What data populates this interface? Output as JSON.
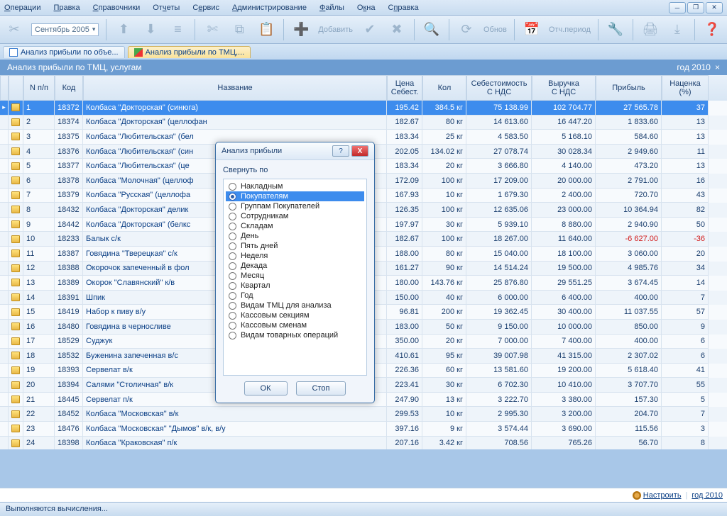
{
  "menus": [
    "Операции",
    "Правка",
    "Справочники",
    "Отчеты",
    "Сервис",
    "Администрирование",
    "Файлы",
    "Окна",
    "Справка"
  ],
  "toolbar": {
    "date": "Сентябрь 2005",
    "add": "Добавить",
    "refresh": "Обнов",
    "acct_period": "Отч.период"
  },
  "tabs": [
    {
      "label": "Анализ прибыли по объе..."
    },
    {
      "label": "Анализ прибыли по ТМЦ,..."
    }
  ],
  "doc_title": "Анализ прибыли по ТМЦ, услугам",
  "doc_period": "год 2010",
  "headers": {
    "np": "N п/п",
    "code": "Код",
    "name": "Название",
    "price": "Цена\nСебест.",
    "qty": "Кол",
    "cost": "Себестоимость\nС НДС",
    "rev": "Выручка\nС НДС",
    "profit": "Прибыль",
    "margin": "Наценка\n(%)"
  },
  "rows": [
    {
      "n": "1",
      "code": "18372",
      "name": "Колбаса \"Докторская\" (синюга)",
      "price": "195.42",
      "qty": "384.5 кг",
      "cost": "75 138.99",
      "rev": "102 704.77",
      "profit": "27 565.78",
      "mar": "37",
      "sel": true
    },
    {
      "n": "2",
      "code": "18374",
      "name": "Колбаса \"Докторская\" (целлофан",
      "price": "182.67",
      "qty": "80 кг",
      "cost": "14 613.60",
      "rev": "16 447.20",
      "profit": "1 833.60",
      "mar": "13"
    },
    {
      "n": "3",
      "code": "18375",
      "name": "Колбаса \"Любительская\" (бел",
      "price": "183.34",
      "qty": "25 кг",
      "cost": "4 583.50",
      "rev": "5 168.10",
      "profit": "584.60",
      "mar": "13"
    },
    {
      "n": "4",
      "code": "18376",
      "name": "Колбаса \"Любительская\" (син",
      "price": "202.05",
      "qty": "134.02 кг",
      "cost": "27 078.74",
      "rev": "30 028.34",
      "profit": "2 949.60",
      "mar": "11"
    },
    {
      "n": "5",
      "code": "18377",
      "name": "Колбаса \"Любительская\" (це",
      "price": "183.34",
      "qty": "20 кг",
      "cost": "3 666.80",
      "rev": "4 140.00",
      "profit": "473.20",
      "mar": "13"
    },
    {
      "n": "6",
      "code": "18378",
      "name": "Колбаса \"Молочная\" (целлоф",
      "price": "172.09",
      "qty": "100 кг",
      "cost": "17 209.00",
      "rev": "20 000.00",
      "profit": "2 791.00",
      "mar": "16"
    },
    {
      "n": "7",
      "code": "18379",
      "name": "Колбаса \"Русская\" (целлофа",
      "price": "167.93",
      "qty": "10 кг",
      "cost": "1 679.30",
      "rev": "2 400.00",
      "profit": "720.70",
      "mar": "43"
    },
    {
      "n": "8",
      "code": "18432",
      "name": "Колбаса \"Докторская\" делик",
      "price": "126.35",
      "qty": "100 кг",
      "cost": "12 635.06",
      "rev": "23 000.00",
      "profit": "10 364.94",
      "mar": "82"
    },
    {
      "n": "9",
      "code": "18442",
      "name": "Колбаса \"Докторская\" (белкс",
      "price": "197.97",
      "qty": "30 кг",
      "cost": "5 939.10",
      "rev": "8 880.00",
      "profit": "2 940.90",
      "mar": "50"
    },
    {
      "n": "10",
      "code": "18233",
      "name": "Балык с/к",
      "price": "182.67",
      "qty": "100 кг",
      "cost": "18 267.00",
      "rev": "11 640.00",
      "profit": "-6 627.00",
      "mar": "-36",
      "neg": true
    },
    {
      "n": "11",
      "code": "18387",
      "name": "Говядина \"Тверецкая\" с/к",
      "price": "188.00",
      "qty": "80 кг",
      "cost": "15 040.00",
      "rev": "18 100.00",
      "profit": "3 060.00",
      "mar": "20"
    },
    {
      "n": "12",
      "code": "18388",
      "name": "Окорочок запеченный в фол",
      "price": "161.27",
      "qty": "90 кг",
      "cost": "14 514.24",
      "rev": "19 500.00",
      "profit": "4 985.76",
      "mar": "34"
    },
    {
      "n": "13",
      "code": "18389",
      "name": "Окорок \"Славянский\" к/в",
      "price": "180.00",
      "qty": "143.76 кг",
      "cost": "25 876.80",
      "rev": "29 551.25",
      "profit": "3 674.45",
      "mar": "14"
    },
    {
      "n": "14",
      "code": "18391",
      "name": "Шпик",
      "price": "150.00",
      "qty": "40 кг",
      "cost": "6 000.00",
      "rev": "6 400.00",
      "profit": "400.00",
      "mar": "7"
    },
    {
      "n": "15",
      "code": "18419",
      "name": "Набор к пиву в/у",
      "price": "96.81",
      "qty": "200 кг",
      "cost": "19 362.45",
      "rev": "30 400.00",
      "profit": "11 037.55",
      "mar": "57"
    },
    {
      "n": "16",
      "code": "18480",
      "name": "Говядина в черносливе",
      "price": "183.00",
      "qty": "50 кг",
      "cost": "9 150.00",
      "rev": "10 000.00",
      "profit": "850.00",
      "mar": "9"
    },
    {
      "n": "17",
      "code": "18529",
      "name": "Суджук",
      "price": "350.00",
      "qty": "20 кг",
      "cost": "7 000.00",
      "rev": "7 400.00",
      "profit": "400.00",
      "mar": "6"
    },
    {
      "n": "18",
      "code": "18532",
      "name": "Буженина запеченная в/с",
      "price": "410.61",
      "qty": "95 кг",
      "cost": "39 007.98",
      "rev": "41 315.00",
      "profit": "2 307.02",
      "mar": "6"
    },
    {
      "n": "19",
      "code": "18393",
      "name": "Сервелат в/к",
      "price": "226.36",
      "qty": "60 кг",
      "cost": "13 581.60",
      "rev": "19 200.00",
      "profit": "5 618.40",
      "mar": "41"
    },
    {
      "n": "20",
      "code": "18394",
      "name": "Салями \"Столичная\" в/к",
      "price": "223.41",
      "qty": "30 кг",
      "cost": "6 702.30",
      "rev": "10 410.00",
      "profit": "3 707.70",
      "mar": "55"
    },
    {
      "n": "21",
      "code": "18445",
      "name": "Сервелат п/к",
      "price": "247.90",
      "qty": "13 кг",
      "cost": "3 222.70",
      "rev": "3 380.00",
      "profit": "157.30",
      "mar": "5"
    },
    {
      "n": "22",
      "code": "18452",
      "name": "Колбаса \"Московская\" в/к",
      "price": "299.53",
      "qty": "10 кг",
      "cost": "2 995.30",
      "rev": "3 200.00",
      "profit": "204.70",
      "mar": "7"
    },
    {
      "n": "23",
      "code": "18476",
      "name": "Колбаса \"Московская\" \"Дымов\" в/к, в/у",
      "price": "397.16",
      "qty": "9 кг",
      "cost": "3 574.44",
      "rev": "3 690.00",
      "profit": "115.56",
      "mar": "3"
    },
    {
      "n": "24",
      "code": "18398",
      "name": "Колбаса \"Краковская\" п/к",
      "price": "207.16",
      "qty": "3.42 кг",
      "cost": "708.56",
      "rev": "765.26",
      "profit": "56.70",
      "mar": "8"
    }
  ],
  "dialog": {
    "title": "Анализ прибыли",
    "group_by": "Свернуть по",
    "options": [
      "Накладным",
      "Покупателям",
      "Группам Покупателей",
      "Сотрудникам",
      "Складам",
      "День",
      "Пять дней",
      "Неделя",
      "Декада",
      "Месяц",
      "Квартал",
      "Год",
      "Видам ТМЦ для анализа",
      "Кассовым секциям",
      "Кассовым сменам",
      "Видам товарных операций"
    ],
    "selected": 1,
    "ok": "ОК",
    "stop": "Стоп"
  },
  "status": {
    "configure": "Настроить",
    "period": "год 2010",
    "footer": "Выполняются вычисления..."
  }
}
